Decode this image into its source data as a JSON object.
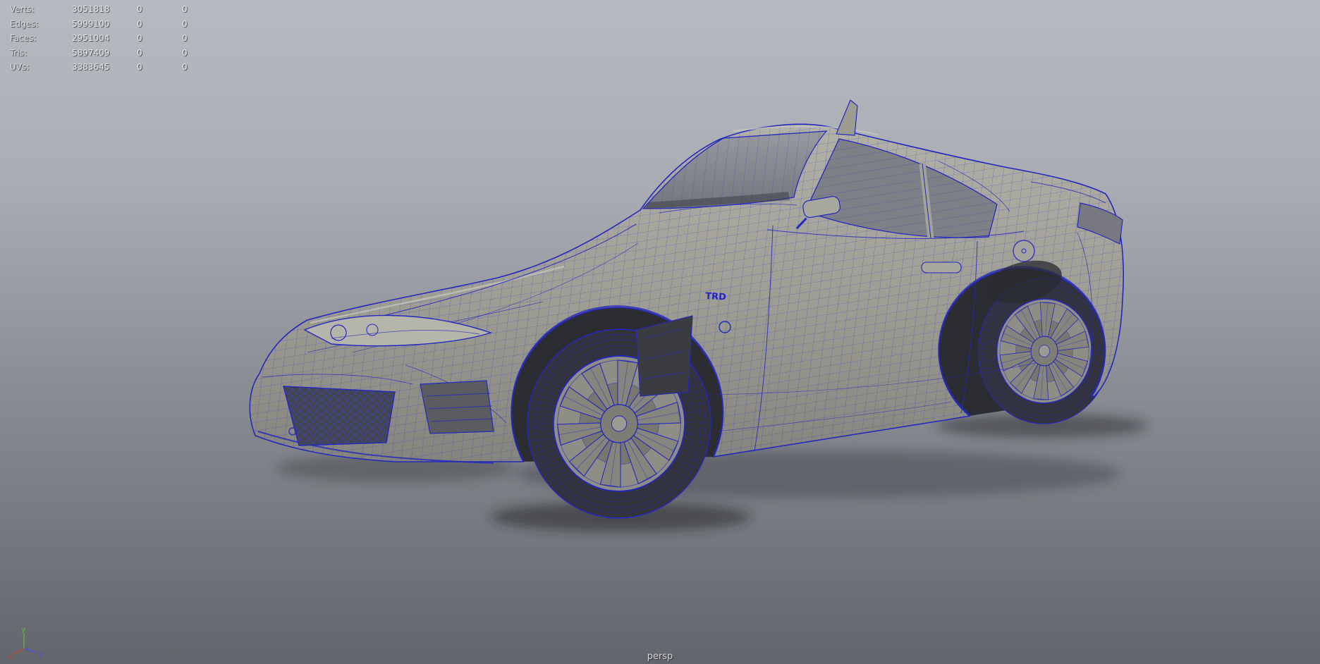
{
  "hud": {
    "rows": [
      {
        "label": "Verts:",
        "total": "3051818",
        "sel": "0",
        "extra": "0"
      },
      {
        "label": "Edges:",
        "total": "5999100",
        "sel": "0",
        "extra": "0"
      },
      {
        "label": "Faces:",
        "total": "2951004",
        "sel": "0",
        "extra": "0"
      },
      {
        "label": "Tris:",
        "total": "5897409",
        "sel": "0",
        "extra": "0"
      },
      {
        "label": "UVs:",
        "total": "3383645",
        "sel": "0",
        "extra": "0"
      }
    ]
  },
  "viewport": {
    "camera_label": "persp",
    "background_top": "#b7bbc1",
    "background_bottom": "#62656b",
    "wireframe_color": "#2428bc",
    "body_color": "#9d9c93"
  },
  "model": {
    "badge": "TRD"
  },
  "axis_gizmo": {
    "x_label": "x",
    "y_label": "y",
    "z_label": "z",
    "x_color": "#c2493a",
    "y_color": "#5fb348",
    "z_color": "#4a52d6"
  }
}
